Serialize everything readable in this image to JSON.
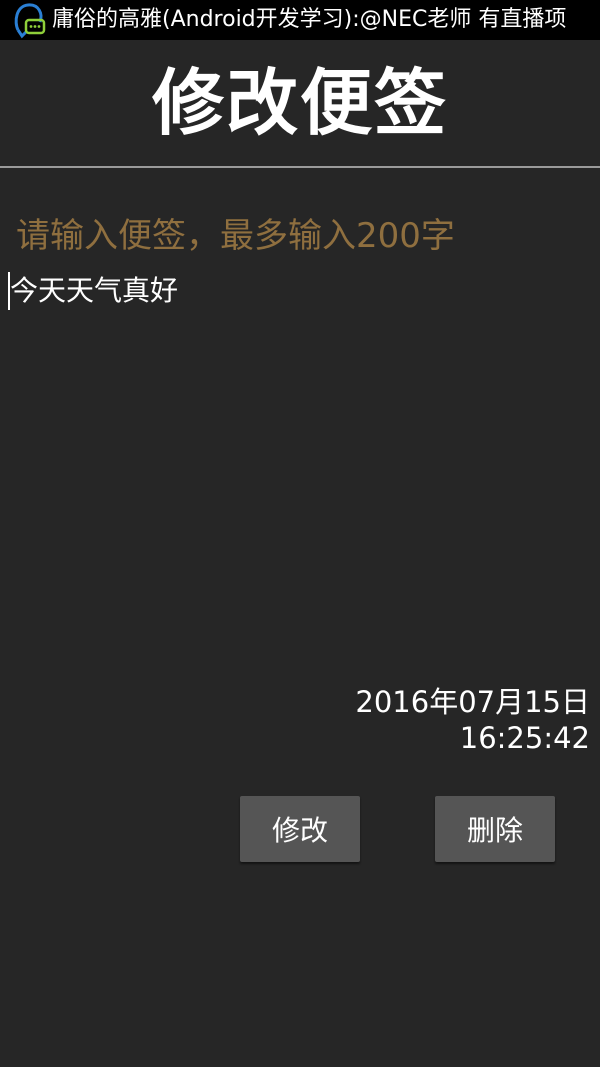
{
  "status_bar": {
    "notification_text": "庸俗的高雅(Android开发学习):@NEC老师 有直播项",
    "icon": "chat-notification-icon",
    "icon_colors": {
      "outline": "#2a7fd4",
      "bubble": "#8fcf3a"
    }
  },
  "header": {
    "title": "修改便签"
  },
  "editor": {
    "hint": "请输入便签，最多输入200字",
    "value": "今天天气真好"
  },
  "timestamp": {
    "date": "2016年07月15日",
    "time": "16:25:42"
  },
  "actions": {
    "modify_label": "修改",
    "delete_label": "删除"
  },
  "colors": {
    "background": "#262626",
    "hint": "#8f6f3f",
    "button": "#555555",
    "divider": "#9a9a9a"
  }
}
